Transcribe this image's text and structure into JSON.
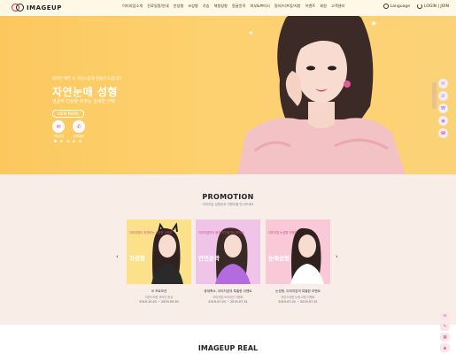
{
  "header": {
    "logo_text": "IMAGEUP",
    "nav": [
      "이미지업소개",
      "진료일정/안내",
      "안성형",
      "코성형",
      "가슴",
      "체형성형",
      "얼굴윤곽",
      "피부&쁘띠시",
      "필러/리프팅/지방",
      "이벤트",
      "회원",
      "고객센터"
    ],
    "language": "Language",
    "login": "LOGIN | JOIN"
  },
  "hero": {
    "sub1": "원하던 예쁜 눈 자연스럽게 만들어 드립니다",
    "title": "자연눈매 성형",
    "sub2": "얼굴의 인상을 바꾸는 섬세한 선택",
    "more": "VIEW MORE",
    "icons": [
      {
        "name": "kakao-icon",
        "glyph": "✉",
        "label": "카톡상담"
      },
      {
        "name": "chat-icon",
        "glyph": "✆",
        "label": "전화상담"
      }
    ],
    "dots": [
      true,
      false,
      false,
      false,
      false
    ]
  },
  "side_rail": [
    {
      "name": "kakao-rail-icon",
      "glyph": "✉"
    },
    {
      "name": "chat-rail-icon",
      "glyph": "✆"
    },
    {
      "name": "price-rail-icon",
      "glyph": "₩"
    },
    {
      "name": "location-rail-icon",
      "glyph": "◉"
    },
    {
      "name": "phone-rail-icon",
      "glyph": "☎"
    }
  ],
  "promotion": {
    "title": "PROMOTION",
    "subtitle": "이미지업 성형외과 이벤트를 만나보세요",
    "prev": "‹",
    "next": "›",
    "cards": [
      {
        "badge": "이미지업이 추천하는 코성형 이벤트",
        "label": "코성형",
        "title": "코 프로모션",
        "desc": "자연스러운 코라인 완성",
        "date": "2019-10-01 ~ 2019-09-30",
        "bg": "#fbe28a"
      },
      {
        "badge": "이미지업만의 윤곽 라인을 만나보세요",
        "label": "안면윤곽",
        "title": "광대축소, 이미지업의 특별한 이벤트",
        "desc": "이미지업 브이라인 이벤트",
        "date": "2019-07-01 ~ 2019-07-31",
        "bg": "#f0c4e8"
      },
      {
        "badge": "이미지업 눈성형 이벤트",
        "label": "눈매성형",
        "title": "눈성형, 이미지업의 특별한 이벤트",
        "desc": "자연스러운 눈매 교정 이벤트",
        "date": "2019-07-01 ~ 2019-07-31",
        "bg": "#f9c9d8"
      }
    ]
  },
  "real": {
    "title": "IMAGEUP REAL"
  },
  "float_rail": [
    {
      "name": "kakao-float-icon",
      "glyph": "✉"
    },
    {
      "name": "counsel-float-icon",
      "glyph": "✎"
    },
    {
      "name": "calendar-float-icon",
      "glyph": "▦"
    },
    {
      "name": "top-float-icon",
      "glyph": "▲"
    }
  ]
}
